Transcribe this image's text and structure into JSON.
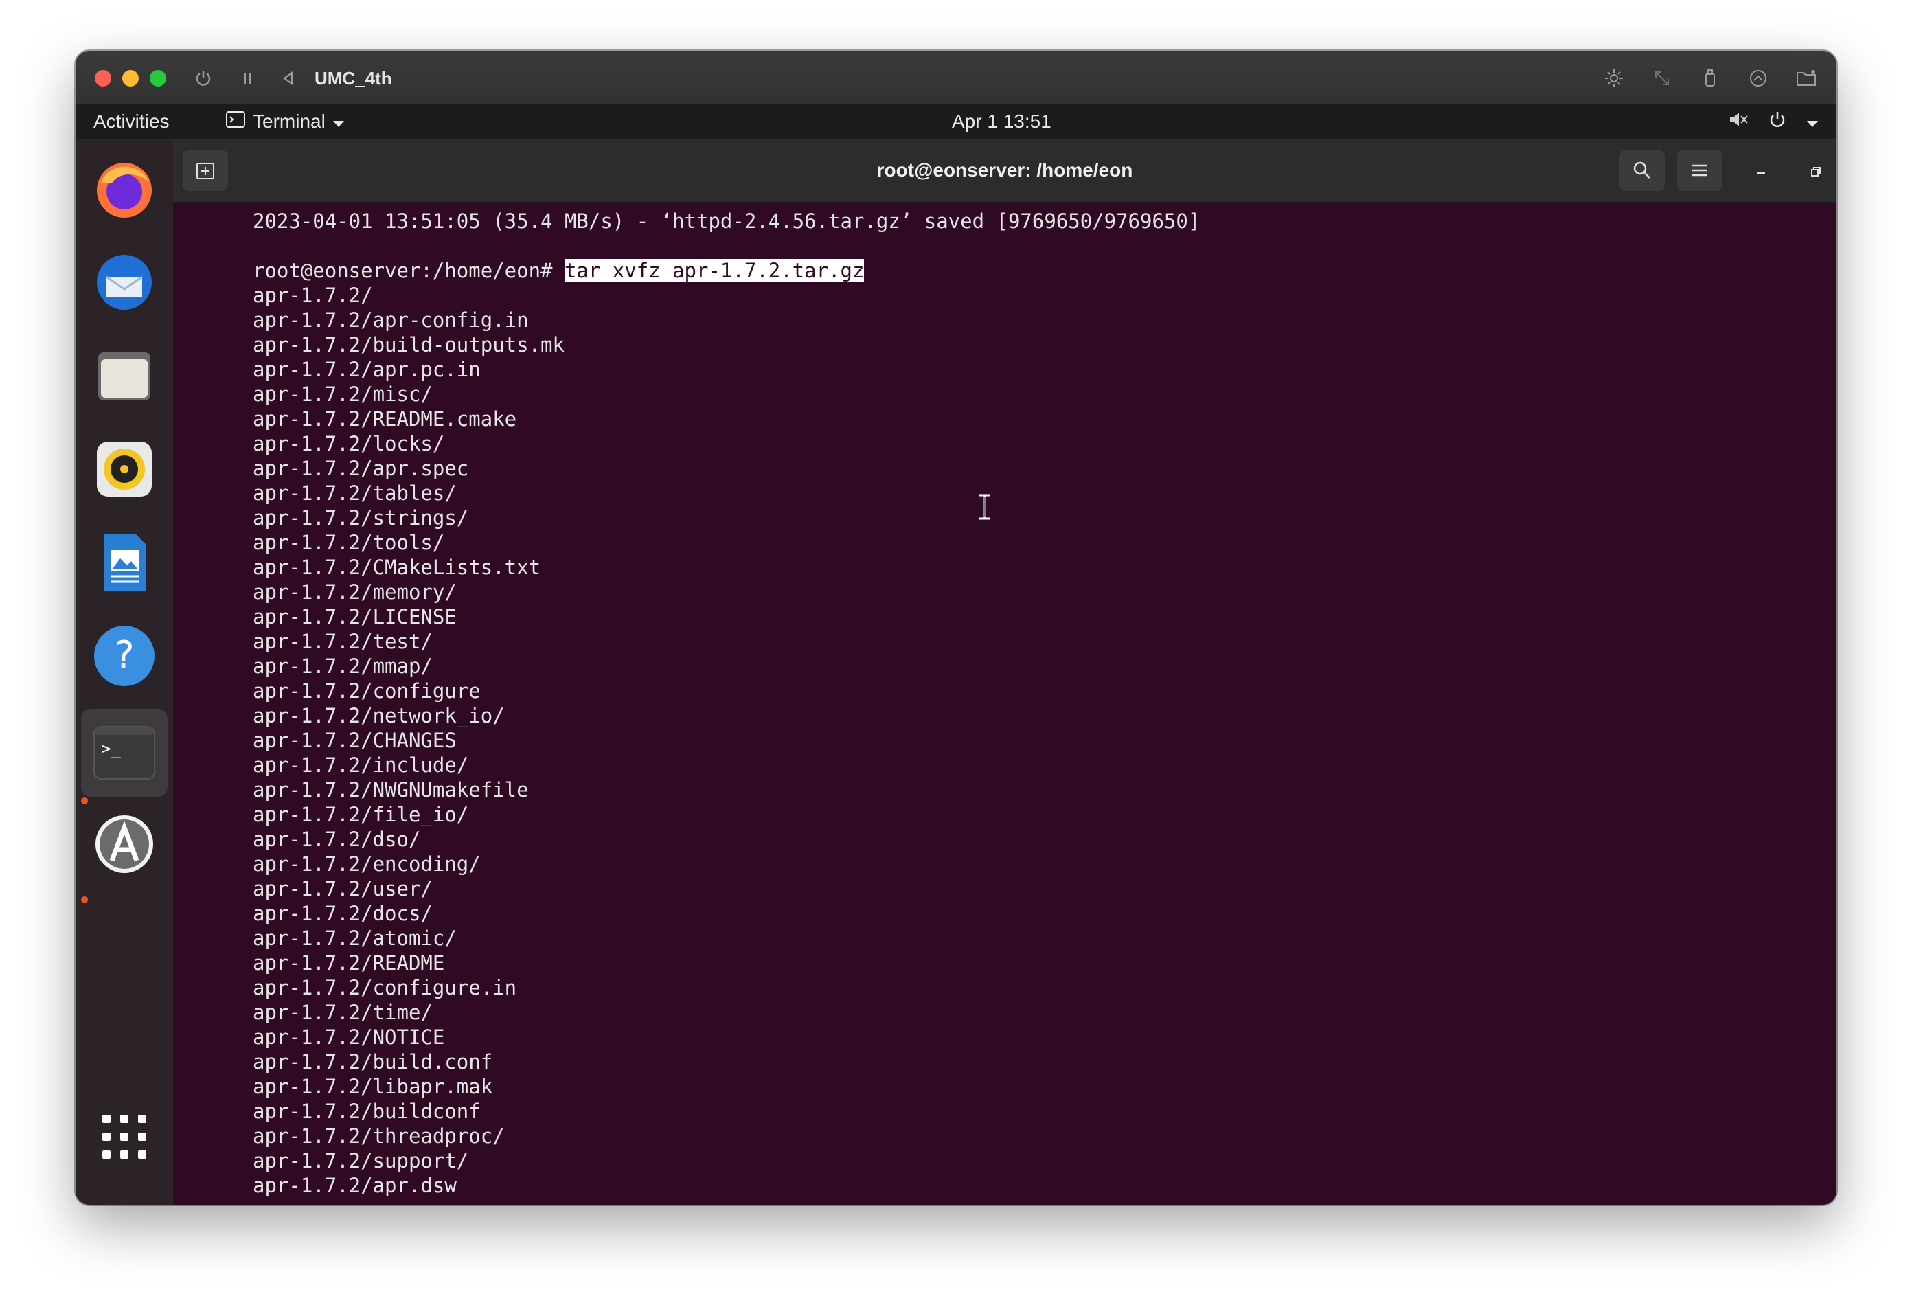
{
  "host": {
    "title": "UMC_4th",
    "controls": [
      "power-icon",
      "pause-icon",
      "back-icon",
      "brightness-icon",
      "resize-icon",
      "usb-icon",
      "sound-icon",
      "folder-icon"
    ]
  },
  "topbar": {
    "activities": "Activities",
    "app_name": "Terminal",
    "clock": "Apr 1  13:51",
    "tray_icons": [
      "volume-muted-icon",
      "power-icon",
      "chevron-down-icon"
    ]
  },
  "dock": {
    "items": [
      {
        "name": "firefox",
        "icon": "firefox-icon"
      },
      {
        "name": "thunderbird",
        "icon": "thunderbird-icon"
      },
      {
        "name": "files",
        "icon": "files-icon"
      },
      {
        "name": "rhythmbox",
        "icon": "rhythmbox-icon"
      },
      {
        "name": "writer",
        "icon": "writer-icon"
      },
      {
        "name": "help",
        "icon": "help-icon"
      },
      {
        "name": "terminal",
        "icon": "terminal-icon",
        "active": true
      },
      {
        "name": "software",
        "icon": "software-icon"
      },
      {
        "name": "show-apps",
        "icon": "grid-icon"
      }
    ],
    "help_glyph": "?",
    "terminal_glyph": ">_"
  },
  "terminal": {
    "title": "root@eonserver: /home/eon",
    "prompt": "root@eonserver:/home/eon# ",
    "command": "tar xvfz apr-1.7.2.tar.gz",
    "lines_before": [
      "2023-04-01 13:51:05 (35.4 MB/s) - ‘httpd-2.4.56.tar.gz’ saved [9769650/9769650]",
      ""
    ],
    "output": [
      "apr-1.7.2/",
      "apr-1.7.2/apr-config.in",
      "apr-1.7.2/build-outputs.mk",
      "apr-1.7.2/apr.pc.in",
      "apr-1.7.2/misc/",
      "apr-1.7.2/README.cmake",
      "apr-1.7.2/locks/",
      "apr-1.7.2/apr.spec",
      "apr-1.7.2/tables/",
      "apr-1.7.2/strings/",
      "apr-1.7.2/tools/",
      "apr-1.7.2/CMakeLists.txt",
      "apr-1.7.2/memory/",
      "apr-1.7.2/LICENSE",
      "apr-1.7.2/test/",
      "apr-1.7.2/mmap/",
      "apr-1.7.2/configure",
      "apr-1.7.2/network_io/",
      "apr-1.7.2/CHANGES",
      "apr-1.7.2/include/",
      "apr-1.7.2/NWGNUmakefile",
      "apr-1.7.2/file_io/",
      "apr-1.7.2/dso/",
      "apr-1.7.2/encoding/",
      "apr-1.7.2/user/",
      "apr-1.7.2/docs/",
      "apr-1.7.2/atomic/",
      "apr-1.7.2/README",
      "apr-1.7.2/configure.in",
      "apr-1.7.2/time/",
      "apr-1.7.2/NOTICE",
      "apr-1.7.2/build.conf",
      "apr-1.7.2/libapr.mak",
      "apr-1.7.2/buildconf",
      "apr-1.7.2/threadproc/",
      "apr-1.7.2/support/",
      "apr-1.7.2/apr.dsw"
    ]
  },
  "colors": {
    "terminal_bg": "#300a24",
    "accent": "#e95420",
    "text": "#e6e6e6"
  }
}
